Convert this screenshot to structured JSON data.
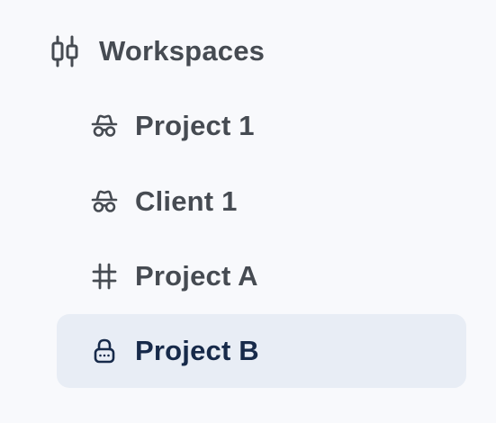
{
  "sidebar": {
    "section": {
      "title": "Workspaces",
      "icon": "workspaces-icon"
    },
    "items": [
      {
        "label": "Project 1",
        "icon": "incognito-icon",
        "active": false
      },
      {
        "label": "Client 1",
        "icon": "incognito-icon",
        "active": false
      },
      {
        "label": "Project A",
        "icon": "hash-icon",
        "active": false
      },
      {
        "label": "Project B",
        "icon": "lock-icon",
        "active": true
      }
    ]
  },
  "colors": {
    "text": "#464b52",
    "active_text": "#172a4a",
    "active_bg": "#e8edf5",
    "background": "#f8f9fc"
  }
}
